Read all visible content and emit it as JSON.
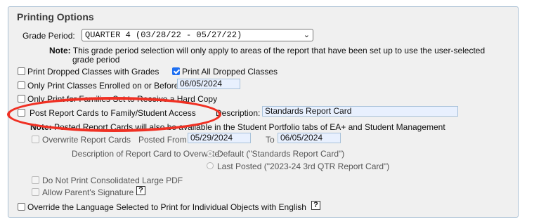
{
  "panel": {
    "title": "Printing Options"
  },
  "grade_period": {
    "label": "Grade Period:",
    "selected": "QUARTER 4 (03/28/22 - 05/27/22)",
    "note_label": "Note:",
    "note_line1": "This grade period selection will only apply to areas of the report that have been set up to use the user-selected",
    "note_line2": "grade period"
  },
  "options": {
    "print_dropped": {
      "label": "Print Dropped Classes with Grades",
      "checked": false
    },
    "print_all_dropped": {
      "label": "Print All Dropped Classes",
      "checked": true
    },
    "only_enrolled": {
      "label": "Only Print Classes Enrolled on or Before",
      "checked": false,
      "date": "06/05/2024"
    },
    "only_families": {
      "label": "Only Print for Families Set to Receive a Hard Copy",
      "checked": false
    },
    "post_report_cards": {
      "label": "Post Report Cards to Family/Student Access",
      "checked": false
    },
    "description_label": "Description:",
    "description_value": "Standards Report Card"
  },
  "posted_note": {
    "label": "Note:",
    "text": "Posted Report Cards will also be available in the Student Portfolio tabs of EA+ and Student Management"
  },
  "overwrite": {
    "label": "Overwrite Report Cards",
    "posted_from_label": "Posted From",
    "posted_from": "05/29/2024",
    "to_label": "To",
    "to": "06/05/2024",
    "desc_label": "Description of Report Card to Overwrite:",
    "radio_default": "Default (\"Standards Report Card\")",
    "radio_last": "Last Posted (\"2023-24 3rd QTR Report Card\")"
  },
  "misc": {
    "no_pdf": "Do Not Print Consolidated Large PDF",
    "parent_sig": "Allow Parent's Signature",
    "override_lang": "Override the Language Selected to Print for Individual Objects with English",
    "help_glyph": "?"
  },
  "colors": {
    "highlight": "#f03023",
    "field_bg": "#e8f0fe",
    "checkbox_checked": "#1e6ff1"
  }
}
